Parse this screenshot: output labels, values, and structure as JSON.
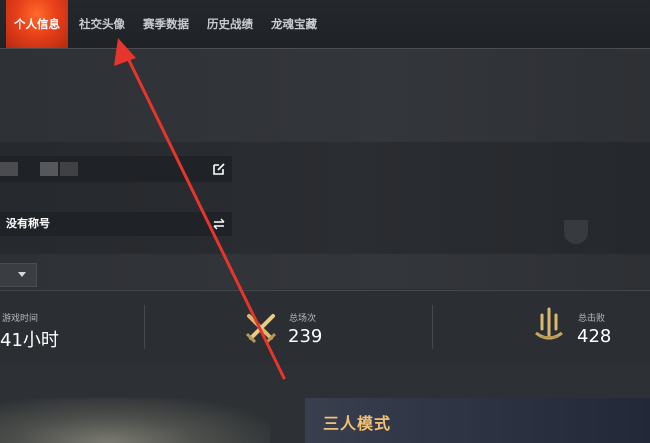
{
  "tabs": [
    {
      "label": "个人信息",
      "active": true
    },
    {
      "label": "社交头像",
      "active": false
    },
    {
      "label": "赛季数据",
      "active": false
    },
    {
      "label": "历史战绩",
      "active": false
    },
    {
      "label": "龙魂宝藏",
      "active": false
    }
  ],
  "profile": {
    "title_text": "没有称号"
  },
  "stats": [
    {
      "label": "游戏时间",
      "value": "41小时",
      "icon": "clock-icon"
    },
    {
      "label": "总场次",
      "value": "239",
      "icon": "crossed-swords-icon"
    },
    {
      "label": "总击败",
      "value": "428",
      "icon": "trident-icon"
    }
  ],
  "modes": {
    "right_label": "三人模式"
  },
  "colors": {
    "accent": "#e8401a",
    "annotation_arrow": "#e8352b",
    "gold": "#f0c078"
  }
}
